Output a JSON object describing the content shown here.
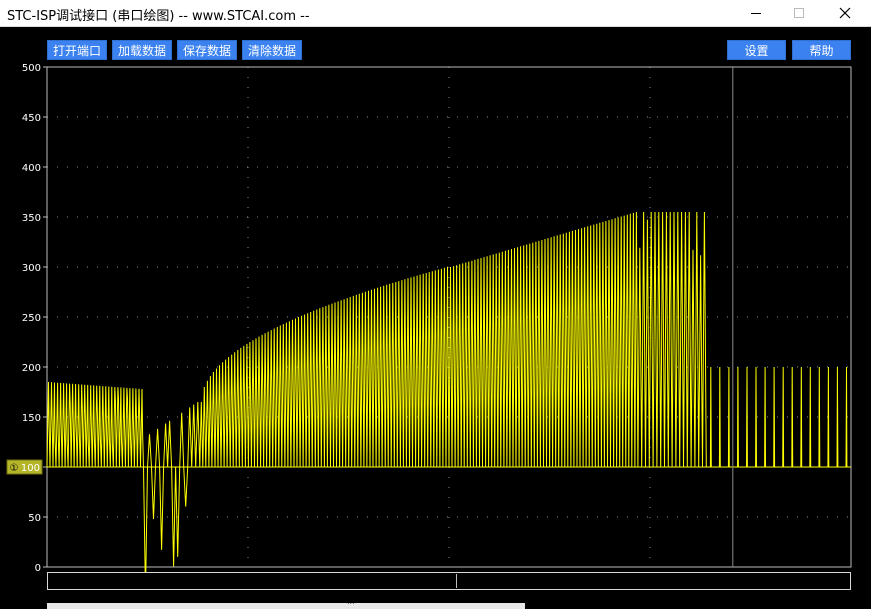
{
  "window": {
    "title": "STC-ISP调试接口 (串口绘图) -- www.STCAI.com --",
    "minimize_icon": "minimize-icon",
    "maximize_icon": "maximize-icon",
    "close_icon": "close-icon"
  },
  "toolbar": {
    "open_port": "打开端口",
    "load_data": "加载数据",
    "save_data": "保存数据",
    "clear_data": "清除数据",
    "settings": "设置",
    "help": "帮助"
  },
  "marker": {
    "icon": "channel-1-marker-icon",
    "label": "①",
    "value": "100"
  },
  "colors": {
    "background": "#000000",
    "trace": "#ffff00",
    "grid": "#8a8a8a",
    "frame": "#bdbdbd",
    "axis_text": "#ffffff",
    "button": "#3b82f0",
    "marker_bg": "#b5b52a"
  },
  "chart_data": {
    "type": "line",
    "title": "",
    "xlabel": "",
    "ylabel": "",
    "ylim": [
      0,
      500
    ],
    "yticks": [
      0,
      50,
      100,
      150,
      200,
      250,
      300,
      350,
      400,
      450,
      500
    ],
    "grid": true,
    "baseline": 100,
    "cursor_fraction": 0.853,
    "series": [
      {
        "color": "#ffff00",
        "segments": [
          {
            "from": 0.0,
            "to": 0.12,
            "count": 32,
            "peak_start": 185,
            "peak_end": 178,
            "low": 100,
            "inner_band": [
              120,
              170
            ]
          },
          {
            "from": 0.12,
            "to": 0.19,
            "count": 14,
            "peak_start": 130,
            "peak_end": 165,
            "low": 100,
            "irregular": true
          },
          {
            "from": 0.19,
            "to": 0.5,
            "count": 82,
            "peak_start": 165,
            "peak_end": 300,
            "low": 100,
            "curve": "sqrt"
          },
          {
            "from": 0.5,
            "to": 0.735,
            "count": 62,
            "peak_start": 300,
            "peak_end": 355,
            "low": 100
          },
          {
            "from": 0.735,
            "to": 0.82,
            "count": 18,
            "peak_start": 355,
            "peak_end": 355,
            "low": 100,
            "irregular": true
          },
          {
            "from": 0.82,
            "to": 1.0,
            "count": 16,
            "peak_start": 200,
            "peak_end": 200,
            "low": 100,
            "sparse": true
          }
        ]
      }
    ]
  },
  "statusbar": {
    "left_text": "",
    "right_text": ""
  },
  "taskbar_strip": {
    "text": "..."
  }
}
